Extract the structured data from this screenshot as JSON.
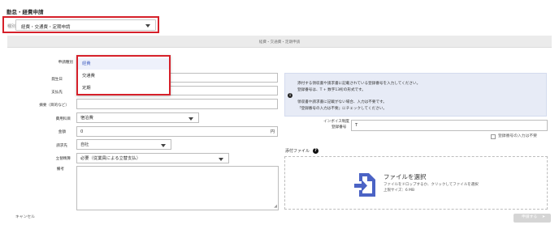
{
  "page": {
    "title": "勤怠・経費申請"
  },
  "type_field": {
    "label": "種別",
    "value": "経費・交通費・定期申請"
  },
  "section": {
    "header": "経費・交通費・定期申請"
  },
  "form": {
    "application_type": {
      "label": "申請種別"
    },
    "application_type_options": [
      "経費",
      "交通費",
      "定期"
    ],
    "date": {
      "label": "発生日"
    },
    "payee": {
      "label": "支払先"
    },
    "summary": {
      "label": "摘要（目的など）"
    },
    "expense_category": {
      "label": "費用科目",
      "value": "宿泊費"
    },
    "amount": {
      "label": "金額",
      "value": "0",
      "unit": "円"
    },
    "billing": {
      "label": "請求先",
      "value": "自社"
    },
    "advance_payment": {
      "label": "立替精算",
      "value": "必要（従業員による立替支払）"
    },
    "remarks": {
      "label": "備考"
    }
  },
  "info": {
    "line1": "添付する領収書や請求書に記載されている登録番号を入力してください。",
    "line2": "登録番号は、T + 数字13桁の形式です。",
    "line3": "領収書や請求書に記載がない場合、入力は不要です。",
    "line4": "「登録番号の入力は不要」にチェックしてください。"
  },
  "invoice": {
    "label_line1": "インボイス制度",
    "label_line2": "登録番号",
    "value": "T",
    "no_input_label": "登録番号の入力は不要"
  },
  "attachment": {
    "label": "添付ファイル",
    "drop_title": "ファイルを選択",
    "drop_desc": "ファイルをドロップするか、クリックしてファイルを選択",
    "drop_limit": "上限サイズ：6 MB"
  },
  "footer": {
    "cancel": "キャンセル",
    "submit": "申請する"
  }
}
